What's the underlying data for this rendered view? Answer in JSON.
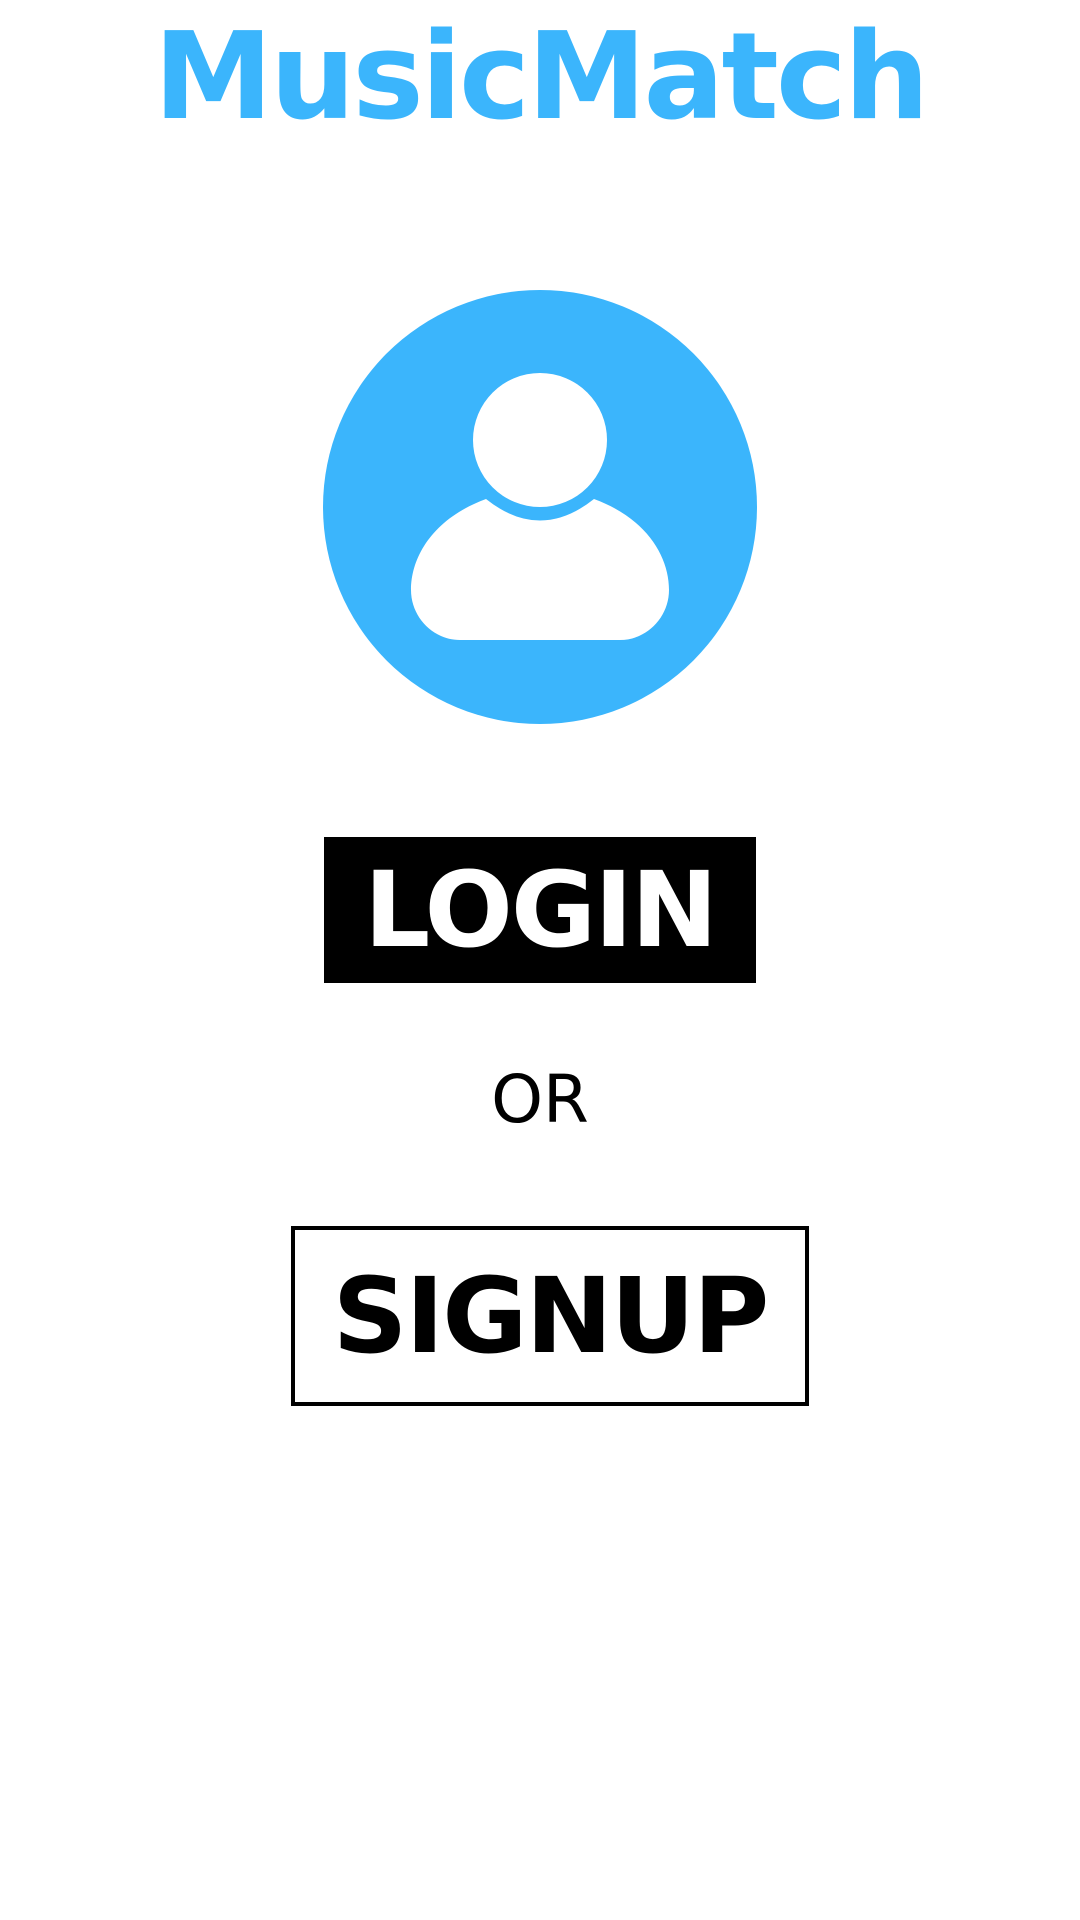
{
  "app": {
    "title": "MusicMatch",
    "accent_color": "#3BB5FC"
  },
  "avatar": {
    "icon": "user-profile-icon"
  },
  "auth": {
    "login_label": "LOGIN",
    "separator": "OR",
    "signup_label": "SIGNUP"
  }
}
